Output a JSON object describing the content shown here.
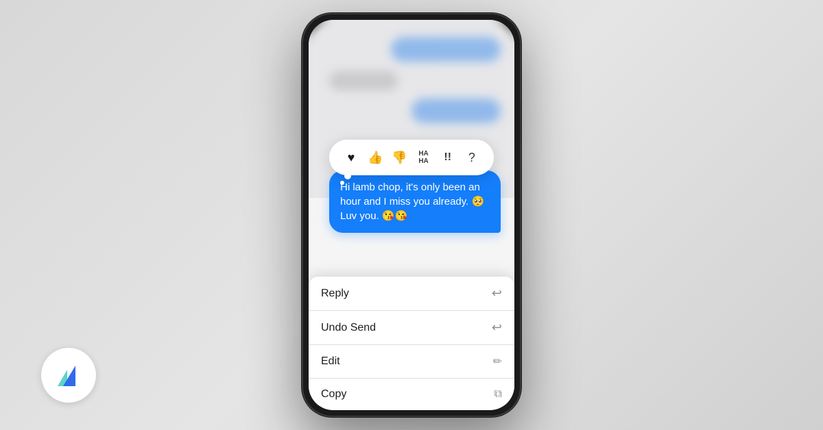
{
  "background": {
    "color": "#e0e0e0"
  },
  "logo": {
    "alt": "API logo"
  },
  "phone": {
    "reactions": [
      {
        "icon": "♥",
        "label": "Heart",
        "emoji": "♥"
      },
      {
        "icon": "👍",
        "label": "Thumbs Up",
        "emoji": "👍"
      },
      {
        "icon": "👎",
        "label": "Thumbs Down",
        "emoji": "👎"
      },
      {
        "icon": "HA\nHA",
        "label": "Haha",
        "emoji": "😂"
      },
      {
        "icon": "!!",
        "label": "Emphasis",
        "emoji": "!!"
      },
      {
        "icon": "?",
        "label": "Question",
        "emoji": "?"
      }
    ],
    "active_message": "Hi lamb chop, it's only been an hour and I miss you already. 🥺 Luv you. 😘😘",
    "context_menu": [
      {
        "label": "Reply",
        "icon": "↩"
      },
      {
        "label": "Undo Send",
        "icon": "↩"
      },
      {
        "label": "Edit",
        "icon": "✏"
      },
      {
        "label": "Copy",
        "icon": "⧉"
      }
    ]
  }
}
